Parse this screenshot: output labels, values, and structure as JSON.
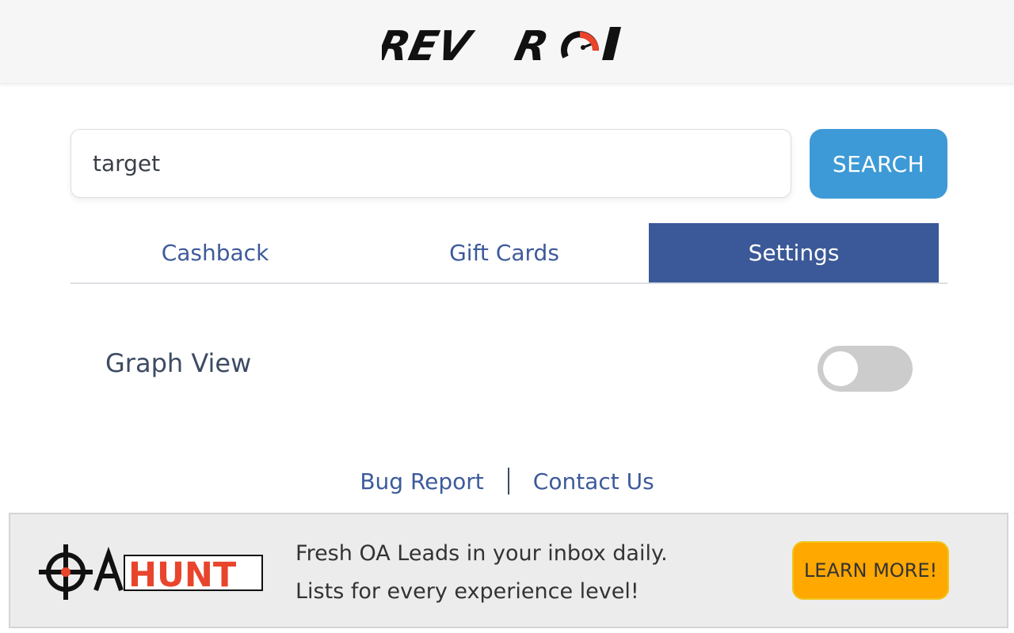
{
  "header": {
    "logo_text": "REV ROI"
  },
  "search": {
    "value": "target",
    "button_label": "SEARCH"
  },
  "tabs": [
    {
      "label": "Cashback",
      "active": false
    },
    {
      "label": "Gift Cards",
      "active": false
    },
    {
      "label": "Settings",
      "active": true
    }
  ],
  "settings": {
    "graph_view_label": "Graph View",
    "graph_view_enabled": false
  },
  "footer": {
    "bug_report": "Bug Report",
    "contact_us": "Contact Us"
  },
  "banner": {
    "logo_text": "OAHUNT",
    "logo_text_highlight": "HUNT",
    "line1": "Fresh OA Leads in your inbox daily.",
    "line2": "Lists for every experience level!",
    "button_label": "LEARN MORE!"
  },
  "colors": {
    "accent_blue": "#3d9ad7",
    "tab_active": "#3b5998",
    "link": "#3d5a9b",
    "banner_button": "#ffa800",
    "logo_red": "#e8452c"
  },
  "icons": {
    "logo": "rev-roi-logo",
    "banner_logo": "oa-hunt-logo"
  }
}
